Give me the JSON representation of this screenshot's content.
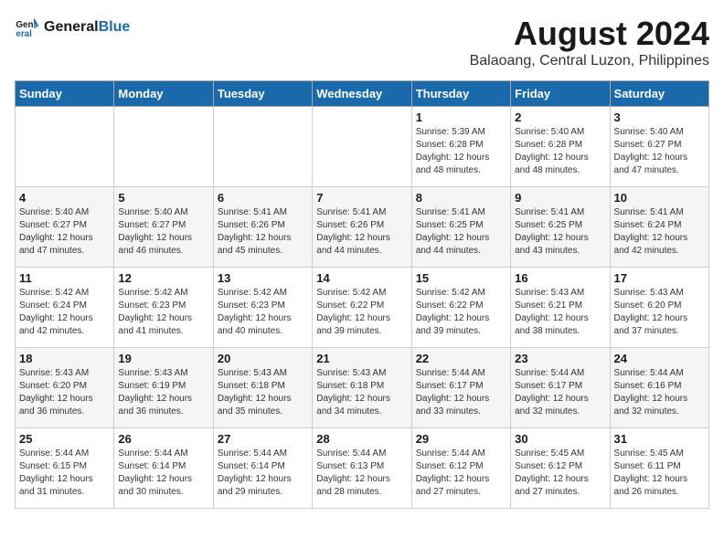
{
  "logo": {
    "text_general": "General",
    "text_blue": "Blue"
  },
  "title": "August 2024",
  "subtitle": "Balaoang, Central Luzon, Philippines",
  "days_of_week": [
    "Sunday",
    "Monday",
    "Tuesday",
    "Wednesday",
    "Thursday",
    "Friday",
    "Saturday"
  ],
  "weeks": [
    [
      {
        "day": "",
        "info": ""
      },
      {
        "day": "",
        "info": ""
      },
      {
        "day": "",
        "info": ""
      },
      {
        "day": "",
        "info": ""
      },
      {
        "day": "1",
        "info": "Sunrise: 5:39 AM\nSunset: 6:28 PM\nDaylight: 12 hours\nand 48 minutes."
      },
      {
        "day": "2",
        "info": "Sunrise: 5:40 AM\nSunset: 6:28 PM\nDaylight: 12 hours\nand 48 minutes."
      },
      {
        "day": "3",
        "info": "Sunrise: 5:40 AM\nSunset: 6:27 PM\nDaylight: 12 hours\nand 47 minutes."
      }
    ],
    [
      {
        "day": "4",
        "info": "Sunrise: 5:40 AM\nSunset: 6:27 PM\nDaylight: 12 hours\nand 47 minutes."
      },
      {
        "day": "5",
        "info": "Sunrise: 5:40 AM\nSunset: 6:27 PM\nDaylight: 12 hours\nand 46 minutes."
      },
      {
        "day": "6",
        "info": "Sunrise: 5:41 AM\nSunset: 6:26 PM\nDaylight: 12 hours\nand 45 minutes."
      },
      {
        "day": "7",
        "info": "Sunrise: 5:41 AM\nSunset: 6:26 PM\nDaylight: 12 hours\nand 44 minutes."
      },
      {
        "day": "8",
        "info": "Sunrise: 5:41 AM\nSunset: 6:25 PM\nDaylight: 12 hours\nand 44 minutes."
      },
      {
        "day": "9",
        "info": "Sunrise: 5:41 AM\nSunset: 6:25 PM\nDaylight: 12 hours\nand 43 minutes."
      },
      {
        "day": "10",
        "info": "Sunrise: 5:41 AM\nSunset: 6:24 PM\nDaylight: 12 hours\nand 42 minutes."
      }
    ],
    [
      {
        "day": "11",
        "info": "Sunrise: 5:42 AM\nSunset: 6:24 PM\nDaylight: 12 hours\nand 42 minutes."
      },
      {
        "day": "12",
        "info": "Sunrise: 5:42 AM\nSunset: 6:23 PM\nDaylight: 12 hours\nand 41 minutes."
      },
      {
        "day": "13",
        "info": "Sunrise: 5:42 AM\nSunset: 6:23 PM\nDaylight: 12 hours\nand 40 minutes."
      },
      {
        "day": "14",
        "info": "Sunrise: 5:42 AM\nSunset: 6:22 PM\nDaylight: 12 hours\nand 39 minutes."
      },
      {
        "day": "15",
        "info": "Sunrise: 5:42 AM\nSunset: 6:22 PM\nDaylight: 12 hours\nand 39 minutes."
      },
      {
        "day": "16",
        "info": "Sunrise: 5:43 AM\nSunset: 6:21 PM\nDaylight: 12 hours\nand 38 minutes."
      },
      {
        "day": "17",
        "info": "Sunrise: 5:43 AM\nSunset: 6:20 PM\nDaylight: 12 hours\nand 37 minutes."
      }
    ],
    [
      {
        "day": "18",
        "info": "Sunrise: 5:43 AM\nSunset: 6:20 PM\nDaylight: 12 hours\nand 36 minutes."
      },
      {
        "day": "19",
        "info": "Sunrise: 5:43 AM\nSunset: 6:19 PM\nDaylight: 12 hours\nand 36 minutes."
      },
      {
        "day": "20",
        "info": "Sunrise: 5:43 AM\nSunset: 6:18 PM\nDaylight: 12 hours\nand 35 minutes."
      },
      {
        "day": "21",
        "info": "Sunrise: 5:43 AM\nSunset: 6:18 PM\nDaylight: 12 hours\nand 34 minutes."
      },
      {
        "day": "22",
        "info": "Sunrise: 5:44 AM\nSunset: 6:17 PM\nDaylight: 12 hours\nand 33 minutes."
      },
      {
        "day": "23",
        "info": "Sunrise: 5:44 AM\nSunset: 6:17 PM\nDaylight: 12 hours\nand 32 minutes."
      },
      {
        "day": "24",
        "info": "Sunrise: 5:44 AM\nSunset: 6:16 PM\nDaylight: 12 hours\nand 32 minutes."
      }
    ],
    [
      {
        "day": "25",
        "info": "Sunrise: 5:44 AM\nSunset: 6:15 PM\nDaylight: 12 hours\nand 31 minutes."
      },
      {
        "day": "26",
        "info": "Sunrise: 5:44 AM\nSunset: 6:14 PM\nDaylight: 12 hours\nand 30 minutes."
      },
      {
        "day": "27",
        "info": "Sunrise: 5:44 AM\nSunset: 6:14 PM\nDaylight: 12 hours\nand 29 minutes."
      },
      {
        "day": "28",
        "info": "Sunrise: 5:44 AM\nSunset: 6:13 PM\nDaylight: 12 hours\nand 28 minutes."
      },
      {
        "day": "29",
        "info": "Sunrise: 5:44 AM\nSunset: 6:12 PM\nDaylight: 12 hours\nand 27 minutes."
      },
      {
        "day": "30",
        "info": "Sunrise: 5:45 AM\nSunset: 6:12 PM\nDaylight: 12 hours\nand 27 minutes."
      },
      {
        "day": "31",
        "info": "Sunrise: 5:45 AM\nSunset: 6:11 PM\nDaylight: 12 hours\nand 26 minutes."
      }
    ]
  ]
}
